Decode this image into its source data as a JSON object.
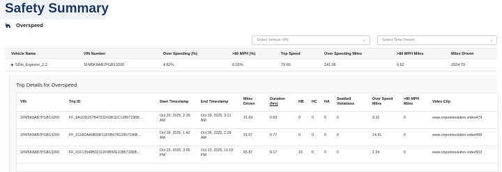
{
  "page_title": "Safety Summary",
  "section": {
    "label": "Overspeed",
    "icon": "speeding-car-icon"
  },
  "filters": {
    "vehicle_vin_placeholder": "Select Vehicle VIN",
    "time_period_placeholder": "Select Time Period"
  },
  "summary": {
    "headers": [
      "Vehicle Name",
      "VIN Number",
      "Over Speeding (%)",
      ">80 MPH (%)",
      "Top Speed",
      "Over Speeding Miles",
      ">80 MPH Miles",
      "Miles Driven"
    ],
    "rows": [
      {
        "expand": "+",
        "vehicle": "SDH_Explorer_2.2",
        "vin": "1FM5K8AB7PGB13200",
        "over_speeding_pct": "4.82%",
        "over80_pct": "0.02%",
        "top_speed": "79.66",
        "over_speeding_miles": "141.05",
        "over80_miles": "0.62",
        "miles_driven": "2924.79"
      }
    ]
  },
  "trip_details": {
    "title": "Trip Details for Overspeed",
    "headers": {
      "vin": "VIN",
      "trip_id": "Trip ID",
      "start": "Start Timestamp",
      "end": "End Timestamp",
      "miles_driven": [
        "Miles",
        "Driven"
      ],
      "duration": [
        "Duration",
        "(hrs)"
      ],
      "hb": "HB",
      "hc": "HC",
      "ha": "HA",
      "seatbelt": [
        "Seatbelt",
        "Violations"
      ],
      "over_speed_miles": [
        "Over Speed",
        "Miles"
      ],
      "over80_miles": [
        ">80 MPH",
        "Miles"
      ],
      "video": "Video Clip"
    },
    "rows": [
      {
        "vin": "1FM5K8AB7PGB13200",
        "trip_id": "FF_8A1DD257B47011F08CEC12857196B…",
        "start": [
          "Oct 29, 2025, 2:39",
          "AM"
        ],
        "end": [
          "Oct 29, 2025, 3:21",
          "AM"
        ],
        "miles_driven": "31.69",
        "duration": "0.69",
        "hb": "0",
        "hc": "0",
        "ha": "0",
        "seatbelt": "0",
        "over_speed_miles": "9.32",
        "over80_miles": "0",
        "video": "www.onpointsolution.video479"
      },
      {
        "vin": "1FM5K8AB7PGB13200",
        "trip_id": "FF_5118CAA9B39F11F0B07812857196B…",
        "start": [
          "Oct 28, 2025, 1:42",
          "AM"
        ],
        "end": [
          "Oct 28, 2025, 2:29",
          "AM"
        ],
        "miles_driven": "31.07",
        "duration": "0.77",
        "hb": "0",
        "hc": "0",
        "ha": "0",
        "seatbelt": "0",
        "over_speed_miles": "14.91",
        "over80_miles": "0",
        "video": "www.onpointsolution.video499"
      },
      {
        "vin": "1FM5K8AB7PGB13200",
        "trip_id": "FF_01F13549B02111F0B50E12857196B…",
        "start": [
          "Oct 23, 2025, 3:00",
          "PM"
        ],
        "end": [
          "Oct 23, 2025, 11:10",
          "PM"
        ],
        "miles_driven": "65.87",
        "duration": "8.17",
        "hb": "15",
        "hc": "0",
        "ha": "0",
        "seatbelt": "0",
        "over_speed_miles": "1.24",
        "over80_miles": "0",
        "video": "www.onpointsolution.video503"
      }
    ]
  },
  "colors": {
    "title": "#1f3a63",
    "title_bg": "#f0f3f8",
    "panel_bg": "#f7f8fa",
    "border": "#e6e8ec"
  }
}
